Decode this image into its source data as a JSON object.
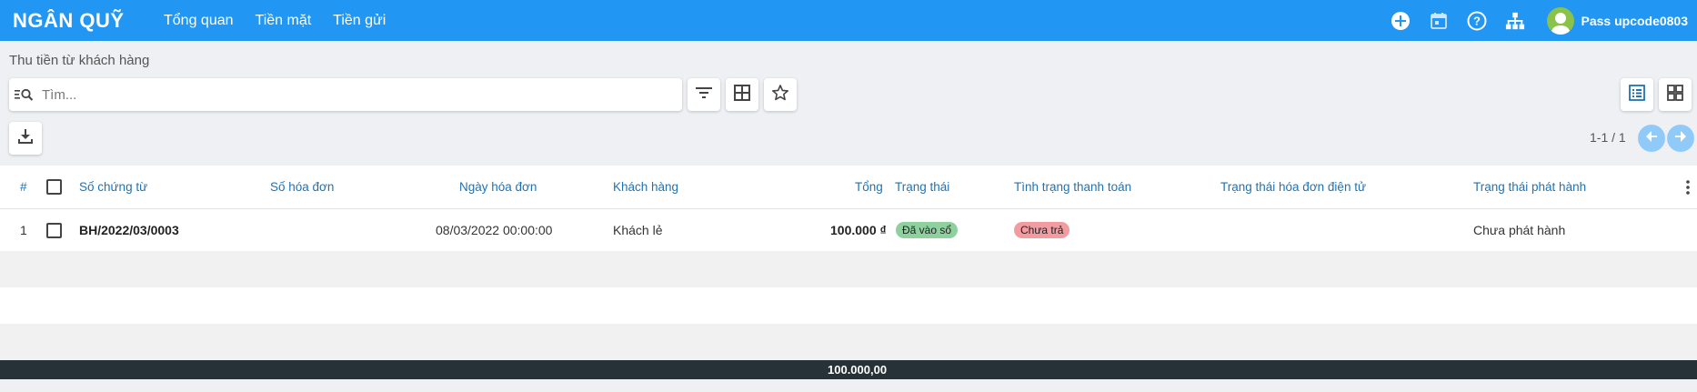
{
  "app": {
    "brand": "NGÂN QUỸ",
    "nav": [
      "Tổng quan",
      "Tiền mặt",
      "Tiền gửi"
    ],
    "user_name": "Pass upcode0803",
    "icons": [
      "add-icon",
      "calendar-icon",
      "help-icon",
      "sitemap-icon",
      "user-avatar-icon"
    ]
  },
  "page": {
    "subtitle": "Thu tiền từ khách hàng",
    "search_placeholder": "Tìm...",
    "pager": "1-1 / 1"
  },
  "table": {
    "headers": {
      "index": "#",
      "voucher_no": "Số chứng từ",
      "invoice_no": "Số hóa đơn",
      "invoice_date": "Ngày hóa đơn",
      "customer": "Khách hàng",
      "total": "Tổng",
      "status": "Trạng thái",
      "payment_status": "Tình trạng thanh toán",
      "einvoice_status": "Trạng thái hóa đơn điện tử",
      "issue_status": "Trạng thái phát hành"
    },
    "rows": [
      {
        "index": "1",
        "voucher_no": "BH/2022/03/0003",
        "invoice_no": "",
        "invoice_date": "08/03/2022 00:00:00",
        "customer": "Khách lẻ",
        "total": "100.000 ₫",
        "status": "Đã vào sổ",
        "payment_status": "Chưa trả",
        "einvoice_status": "",
        "issue_status": "Chưa phát hành"
      }
    ]
  },
  "footer": {
    "total": "100.000,00"
  },
  "colors": {
    "topbar": "#2196f3",
    "header_text": "#1e73b7",
    "badge_posted": "#8fd19e",
    "badge_unpaid": "#f29ba0",
    "footer": "#263238"
  }
}
